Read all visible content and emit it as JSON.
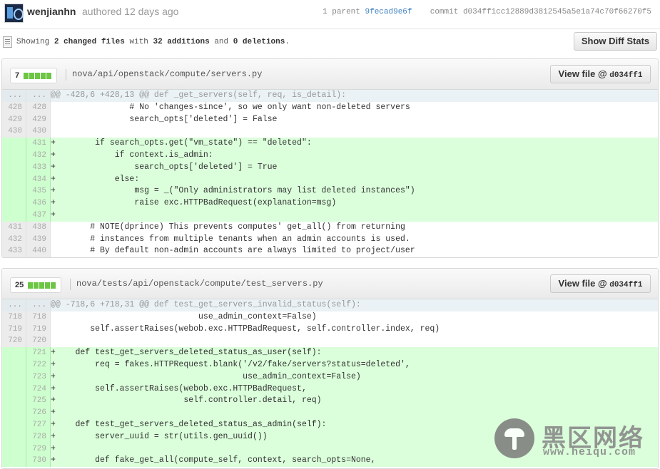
{
  "commit": {
    "author": "wenjianhn",
    "authored": "authored 12 days ago",
    "parent_label": "1 parent",
    "parent_sha": "9fecad9e6f",
    "commit_label": "commit",
    "commit_sha": "d034ff1cc12889d3812545a5e1a74c70f66270f5"
  },
  "toc": {
    "showing": "Showing",
    "changed_files": "2 changed files",
    "with": "with",
    "additions": "32 additions",
    "and": "and",
    "deletions": "0 deletions",
    "period": ".",
    "diff_stats_button": "Show Diff Stats"
  },
  "files": [
    {
      "count": "7",
      "path": "nova/api/openstack/compute/servers.py",
      "view_label": "View file @ ",
      "view_sha": "d034ff1",
      "lines": [
        {
          "type": "hunk",
          "old": "...",
          "new": "...",
          "code": "@@ -428,6 +428,13 @@ def _get_servers(self, req, is_detail):"
        },
        {
          "type": "ctx",
          "old": "428",
          "new": "428",
          "code": "                # No 'changes-since', so we only want non-deleted servers"
        },
        {
          "type": "ctx",
          "old": "429",
          "new": "429",
          "code": "                search_opts['deleted'] = False"
        },
        {
          "type": "ctx",
          "old": "430",
          "new": "430",
          "code": " "
        },
        {
          "type": "add",
          "old": "",
          "new": "431",
          "code": "+        if search_opts.get(\"vm_state\") == \"deleted\":"
        },
        {
          "type": "add",
          "old": "",
          "new": "432",
          "code": "+            if context.is_admin:"
        },
        {
          "type": "add",
          "old": "",
          "new": "433",
          "code": "+                search_opts['deleted'] = True"
        },
        {
          "type": "add",
          "old": "",
          "new": "434",
          "code": "+            else:"
        },
        {
          "type": "add",
          "old": "",
          "new": "435",
          "code": "+                msg = _(\"Only administrators may list deleted instances\")"
        },
        {
          "type": "add",
          "old": "",
          "new": "436",
          "code": "+                raise exc.HTTPBadRequest(explanation=msg)"
        },
        {
          "type": "add",
          "old": "",
          "new": "437",
          "code": "+"
        },
        {
          "type": "ctx",
          "old": "431",
          "new": "438",
          "code": "        # NOTE(dprince) This prevents computes' get_all() from returning"
        },
        {
          "type": "ctx",
          "old": "432",
          "new": "439",
          "code": "        # instances from multiple tenants when an admin accounts is used."
        },
        {
          "type": "ctx",
          "old": "433",
          "new": "440",
          "code": "        # By default non-admin accounts are always limited to project/user"
        }
      ]
    },
    {
      "count": "25",
      "path": "nova/tests/api/openstack/compute/test_servers.py",
      "view_label": "View file @ ",
      "view_sha": "d034ff1",
      "lines": [
        {
          "type": "hunk",
          "old": "...",
          "new": "...",
          "code": "@@ -718,6 +718,31 @@ def test_get_servers_invalid_status(self):"
        },
        {
          "type": "ctx",
          "old": "718",
          "new": "718",
          "code": "                              use_admin_context=False)"
        },
        {
          "type": "ctx",
          "old": "719",
          "new": "719",
          "code": "        self.assertRaises(webob.exc.HTTPBadRequest, self.controller.index, req)"
        },
        {
          "type": "ctx",
          "old": "720",
          "new": "720",
          "code": " "
        },
        {
          "type": "add",
          "old": "",
          "new": "721",
          "code": "+    def test_get_servers_deleted_status_as_user(self):"
        },
        {
          "type": "add",
          "old": "",
          "new": "722",
          "code": "+        req = fakes.HTTPRequest.blank('/v2/fake/servers?status=deleted',"
        },
        {
          "type": "add",
          "old": "",
          "new": "723",
          "code": "+                                      use_admin_context=False)"
        },
        {
          "type": "add",
          "old": "",
          "new": "724",
          "code": "+        self.assertRaises(webob.exc.HTTPBadRequest,"
        },
        {
          "type": "add",
          "old": "",
          "new": "725",
          "code": "+                          self.controller.detail, req)"
        },
        {
          "type": "add",
          "old": "",
          "new": "726",
          "code": "+"
        },
        {
          "type": "add",
          "old": "",
          "new": "727",
          "code": "+    def test_get_servers_deleted_status_as_admin(self):"
        },
        {
          "type": "add",
          "old": "",
          "new": "728",
          "code": "+        server_uuid = str(utils.gen_uuid())"
        },
        {
          "type": "add",
          "old": "",
          "new": "729",
          "code": "+"
        },
        {
          "type": "add",
          "old": "",
          "new": "730",
          "code": "+        def fake_get_all(compute_self, context, search_opts=None,"
        }
      ]
    }
  ],
  "watermark": {
    "title": "黑区网络",
    "url": "www.heiqu.com"
  }
}
